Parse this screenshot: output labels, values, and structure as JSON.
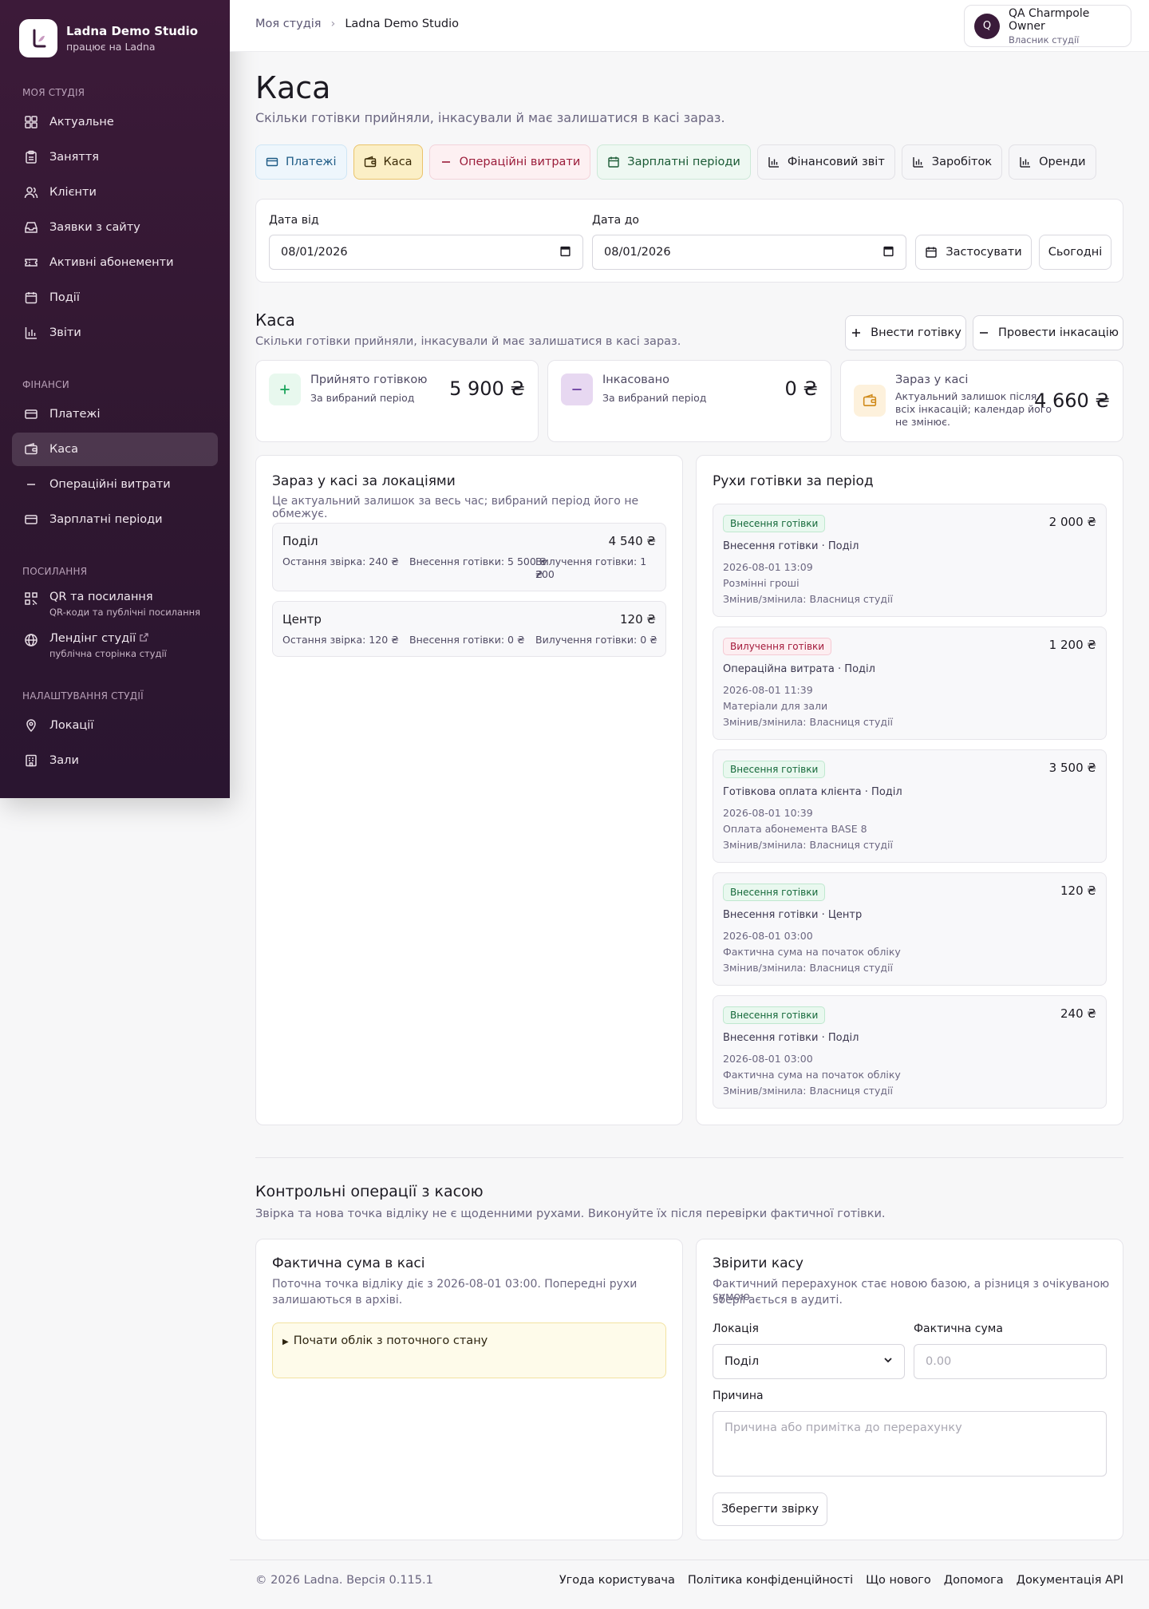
{
  "brand": {
    "name": "Ladna Demo Studio",
    "sub": "працює на Ladna"
  },
  "sidebar": {
    "sec1": "МОЯ СТУДІЯ",
    "items1": [
      {
        "label": "Актуальне"
      },
      {
        "label": "Заняття"
      },
      {
        "label": "Клієнти"
      },
      {
        "label": "Заявки з сайту"
      },
      {
        "label": "Активні абонементи"
      },
      {
        "label": "Події"
      },
      {
        "label": "Звіти"
      }
    ],
    "sec2": "ФІНАНСИ",
    "items2": [
      {
        "label": "Платежі"
      },
      {
        "label": "Каса"
      },
      {
        "label": "Операційні витрати"
      },
      {
        "label": "Зарплатні періоди"
      }
    ],
    "sec3": "ПОСИЛАННЯ",
    "links": [
      {
        "label": "QR та посилання",
        "sub": "QR-коди та публічні посилання"
      },
      {
        "label": "Лендінг студії",
        "sub": "публічна сторінка студії"
      }
    ],
    "sec4": "НАЛАШТУВАННЯ СТУДІЇ",
    "items4": [
      {
        "label": "Локації"
      },
      {
        "label": "Зали"
      }
    ]
  },
  "topbar": {
    "crumb1": "Моя студія",
    "crumb2": "Ladna Demo Studio",
    "user_initial": "Q",
    "user_name": "QA Charmpole Owner",
    "user_role": "Власник студії"
  },
  "page": {
    "title": "Каса",
    "lead": "Скільки готівки прийняли, інкасували й має залишатися в касі зараз."
  },
  "tabs": [
    {
      "label": "Платежі"
    },
    {
      "label": "Каса"
    },
    {
      "label": "Операційні витрати"
    },
    {
      "label": "Зарплатні періоди"
    },
    {
      "label": "Фінансовий звіт"
    },
    {
      "label": "Заробіток"
    },
    {
      "label": "Оренди"
    }
  ],
  "filter": {
    "from_label": "Дата від",
    "from_value": "08/01/2026",
    "to_label": "Дата до",
    "to_value": "08/01/2026",
    "apply": "Застосувати",
    "today": "Сьогодні"
  },
  "cash": {
    "title": "Каса",
    "sub": "Скільки готівки прийняли, інкасували й має залишатися в касі зараз.",
    "deposit_btn": "Внести готівку",
    "collect_btn": "Провести інкасацію",
    "metrics": [
      {
        "title": "Прийнято готівкою",
        "sub": "За вибраний період",
        "value": "5 900 ₴",
        "color": "#1aa35a"
      },
      {
        "title": "Інкасовано",
        "sub": "За вибраний період",
        "value": "0 ₴",
        "color": "#6b3fa0"
      },
      {
        "title": "Зараз у касі",
        "sub1": "Актуальний залишок після",
        "sub2": "всіх інкасацій; календар його",
        "sub3": "не змінює.",
        "value": "4 660 ₴",
        "color": "#d08a1a"
      }
    ]
  },
  "locations": {
    "title": "Зараз у касі за локаціями",
    "sub": "Це актуальний залишок за весь час; вибраний період його не обмежує.",
    "rows": [
      {
        "name": "Поділ",
        "value": "4 540 ₴",
        "check": "Остання звірка: 240 ₴",
        "in": "Внесення готівки: 5 500 ₴",
        "out1": "Вилучення готівки: 1 200",
        "out2": "₴"
      },
      {
        "name": "Центр",
        "value": "120 ₴",
        "check": "Остання звірка: 120 ₴",
        "in": "Внесення готівки: 0 ₴",
        "out1": "Вилучення готівки: 0 ₴",
        "out2": ""
      }
    ]
  },
  "moves": {
    "title": "Рухи готівки за період",
    "rows": [
      {
        "badge": "Внесення готівки",
        "kind": "in",
        "amount": "2 000 ₴",
        "title": "Внесення готівки · Поділ",
        "time": "2026-08-01 13:09",
        "note": "Розмінні гроші",
        "who": "Змінив/змінила: Власниця студії"
      },
      {
        "badge": "Вилучення готівки",
        "kind": "out",
        "amount": "1 200 ₴",
        "title": "Операційна витрата · Поділ",
        "time": "2026-08-01 11:39",
        "note": "Матеріали для зали",
        "who": "Змінив/змінила: Власниця студії"
      },
      {
        "badge": "Внесення готівки",
        "kind": "in",
        "amount": "3 500 ₴",
        "title": "Готівкова оплата клієнта · Поділ",
        "time": "2026-08-01 10:39",
        "note": "Оплата абонемента BASE 8",
        "who": "Змінив/змінила: Власниця студії"
      },
      {
        "badge": "Внесення готівки",
        "kind": "in",
        "amount": "120 ₴",
        "title": "Внесення готівки · Центр",
        "time": "2026-08-01 03:00",
        "note": "Фактична сума на початок обліку",
        "who": "Змінив/змінила: Власниця студії"
      },
      {
        "badge": "Внесення готівки",
        "kind": "in",
        "amount": "240 ₴",
        "title": "Внесення готівки · Поділ",
        "time": "2026-08-01 03:00",
        "note": "Фактична сума на початок обліку",
        "who": "Змінив/змінила: Власниця студії"
      }
    ]
  },
  "control": {
    "title": "Контрольні операції з касою",
    "sub": "Звірка та нова точка відліку не є щоденними рухами. Виконуйте їх після перевірки фактичної готівки.",
    "actual_title": "Фактична сума в касі",
    "actual_sub1": "Поточна точка відліку діє з 2026-08-01 03:00. Попередні рухи",
    "actual_sub2": "залишаються в архіві.",
    "details": "Почати облік з поточного стану",
    "check_title": "Звірити касу",
    "check_sub1": "Фактичний перерахунок стає новою базою, а різниця з очікуваною сумою",
    "check_sub2": "зберігається в аудиті.",
    "loc_label": "Локація",
    "loc_value": "Поділ",
    "sum_label": "Фактична сума",
    "sum_placeholder": "0.00",
    "reason_label": "Причина",
    "reason_placeholder": "Причина або примітка до перерахунку",
    "save": "Зберегти звірку"
  },
  "footer": {
    "copy": "© 2026 Ladna. Версія 0.115.1",
    "links": [
      "Угода користувача",
      "Політика конфіденційності",
      "Що нового",
      "Допомога",
      "Документація API"
    ]
  }
}
